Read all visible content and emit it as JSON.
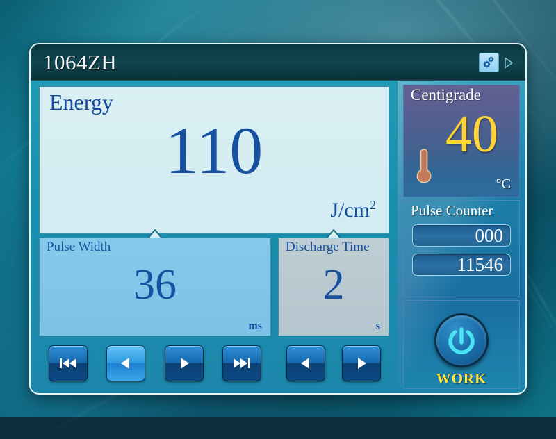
{
  "window": {
    "title": "1064ZH"
  },
  "titlebar": {
    "gear_icon": "gear-icon",
    "next_icon": "play-triangle-icon"
  },
  "energy": {
    "label": "Energy",
    "value": "110",
    "unit_main": "J/cm",
    "unit_sup": "2"
  },
  "pulse_width": {
    "label": "Pulse Width",
    "value": "36",
    "unit": "ms",
    "buttons": [
      {
        "name": "skip-back",
        "glyph": "skip-backward-icon"
      },
      {
        "name": "decrease",
        "glyph": "left-arrow-icon",
        "active": true
      },
      {
        "name": "increase",
        "glyph": "right-arrow-icon",
        "active": false
      },
      {
        "name": "skip-forward",
        "glyph": "skip-forward-icon"
      }
    ]
  },
  "discharge_time": {
    "label": "Discharge Time",
    "value": "2",
    "unit": "s",
    "buttons": [
      {
        "name": "decrease",
        "glyph": "left-arrow-icon",
        "active": false
      },
      {
        "name": "increase",
        "glyph": "right-arrow-icon",
        "active": false
      }
    ]
  },
  "temperature": {
    "label": "Centigrade",
    "value": "40",
    "unit": "°C",
    "icon": "thermometer-icon"
  },
  "pulse_counter": {
    "label": "Pulse Counter",
    "session_count": "000",
    "total_count": "11546"
  },
  "work": {
    "label": "WORK",
    "icon": "power-icon"
  },
  "colors": {
    "header_bg": "#0d3b44",
    "energy_bg": "#d9eff3",
    "energy_text": "#17509f",
    "pulse_width_bg": "#7cc2e7",
    "discharge_bg": "#b8c8d0",
    "temp_value": "#ffd433",
    "work_label": "#ffe23d",
    "power_icon": "#49e3f5",
    "sidebar_bg": "#1b7fa8"
  }
}
